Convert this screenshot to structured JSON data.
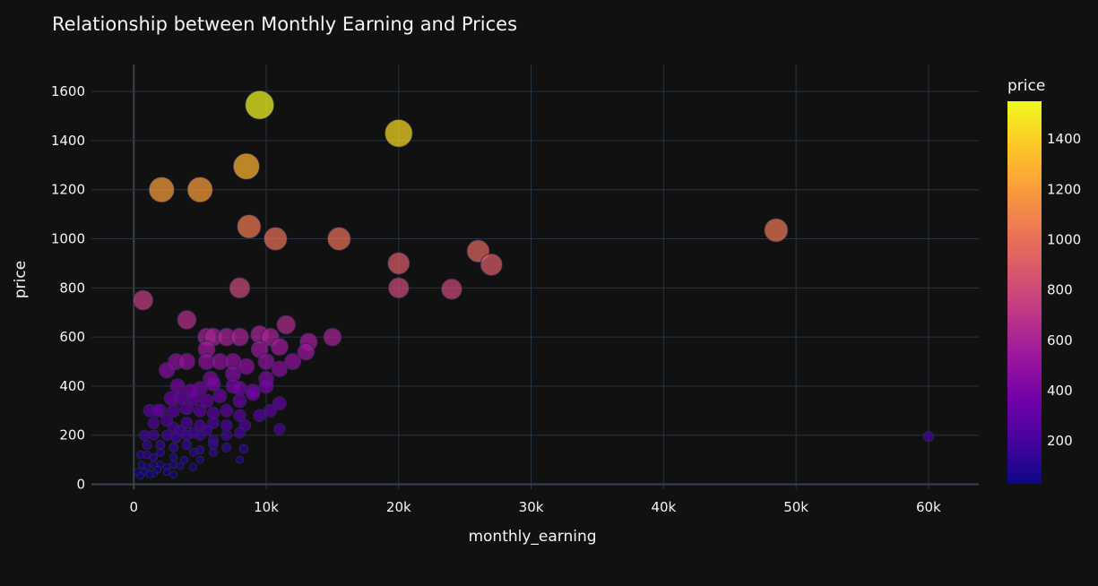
{
  "chart_data": {
    "type": "scatter",
    "title": "Relationship between Monthly Earning and Prices",
    "xlabel": "monthly_earning",
    "ylabel": "price",
    "xlim": [
      -3200,
      63800
    ],
    "ylim": [
      -20,
      1710
    ],
    "x_ticks": [
      0,
      10000,
      20000,
      30000,
      40000,
      50000,
      60000
    ],
    "x_tick_labels": [
      "0",
      "10k",
      "20k",
      "30k",
      "40k",
      "50k",
      "60k"
    ],
    "y_ticks": [
      0,
      200,
      400,
      600,
      800,
      1000,
      1200,
      1400,
      1600
    ],
    "y_tick_labels": [
      "0",
      "200",
      "400",
      "600",
      "800",
      "1000",
      "1200",
      "1400",
      "1600"
    ],
    "grid": true,
    "size_encodes": "price",
    "colorbar": {
      "title": "price",
      "min": 30,
      "max": 1550,
      "ticks": [
        200,
        400,
        600,
        800,
        1000,
        1200,
        1400
      ],
      "tick_labels": [
        "200",
        "400",
        "600",
        "800",
        "1000",
        "1200",
        "1400"
      ]
    },
    "colorscale": [
      "#0d0887",
      "#46039f",
      "#7201a8",
      "#9c179e",
      "#bd3786",
      "#d8576b",
      "#ed7953",
      "#fb9f3a",
      "#fdca26",
      "#f0f921"
    ],
    "points": [
      [
        9500,
        1545
      ],
      [
        20000,
        1430
      ],
      [
        8500,
        1295
      ],
      [
        2100,
        1200
      ],
      [
        5000,
        1200
      ],
      [
        8700,
        1050
      ],
      [
        10700,
        1000
      ],
      [
        15500,
        1000
      ],
      [
        48500,
        1035
      ],
      [
        20000,
        900
      ],
      [
        26000,
        950
      ],
      [
        27000,
        895
      ],
      [
        700,
        750
      ],
      [
        8000,
        800
      ],
      [
        20000,
        800
      ],
      [
        24000,
        795
      ],
      [
        4000,
        670
      ],
      [
        11500,
        650
      ],
      [
        5500,
        600
      ],
      [
        6000,
        600
      ],
      [
        7000,
        600
      ],
      [
        8000,
        600
      ],
      [
        9500,
        610
      ],
      [
        10300,
        600
      ],
      [
        15000,
        600
      ],
      [
        13200,
        580
      ],
      [
        5500,
        550
      ],
      [
        9500,
        550
      ],
      [
        11000,
        560
      ],
      [
        10000,
        500
      ],
      [
        12000,
        500
      ],
      [
        13000,
        540
      ],
      [
        3200,
        500
      ],
      [
        4000,
        500
      ],
      [
        5500,
        500
      ],
      [
        6500,
        500
      ],
      [
        7500,
        500
      ],
      [
        8500,
        480
      ],
      [
        11000,
        470
      ],
      [
        2500,
        465
      ],
      [
        5800,
        430
      ],
      [
        7500,
        450
      ],
      [
        10000,
        430
      ],
      [
        3300,
        400
      ],
      [
        4300,
        380
      ],
      [
        5000,
        390
      ],
      [
        6000,
        410
      ],
      [
        7500,
        400
      ],
      [
        8000,
        390
      ],
      [
        9000,
        380
      ],
      [
        10000,
        400
      ],
      [
        2800,
        350
      ],
      [
        3500,
        350
      ],
      [
        4500,
        350
      ],
      [
        5500,
        340
      ],
      [
        6500,
        360
      ],
      [
        8000,
        340
      ],
      [
        9000,
        370
      ],
      [
        11000,
        330
      ],
      [
        2000,
        300
      ],
      [
        3000,
        300
      ],
      [
        4000,
        310
      ],
      [
        5000,
        300
      ],
      [
        6000,
        290
      ],
      [
        7000,
        300
      ],
      [
        8000,
        280
      ],
      [
        9500,
        280
      ],
      [
        10300,
        300
      ],
      [
        1200,
        300
      ],
      [
        1800,
        300
      ],
      [
        1500,
        250
      ],
      [
        2500,
        260
      ],
      [
        3000,
        230
      ],
      [
        4000,
        250
      ],
      [
        5000,
        240
      ],
      [
        6000,
        250
      ],
      [
        7000,
        240
      ],
      [
        8400,
        240
      ],
      [
        3500,
        220
      ],
      [
        4500,
        210
      ],
      [
        5500,
        220
      ],
      [
        800,
        200
      ],
      [
        1500,
        200
      ],
      [
        2500,
        200
      ],
      [
        3200,
        190
      ],
      [
        4000,
        200
      ],
      [
        5000,
        200
      ],
      [
        6000,
        180
      ],
      [
        7000,
        200
      ],
      [
        8000,
        210
      ],
      [
        11000,
        225
      ],
      [
        60000,
        195
      ],
      [
        1000,
        160
      ],
      [
        2000,
        160
      ],
      [
        3000,
        150
      ],
      [
        4000,
        160
      ],
      [
        5000,
        140
      ],
      [
        6000,
        160
      ],
      [
        7000,
        150
      ],
      [
        8300,
        145
      ],
      [
        4500,
        130
      ],
      [
        500,
        120
      ],
      [
        1000,
        120
      ],
      [
        1500,
        110
      ],
      [
        2000,
        130
      ],
      [
        3000,
        110
      ],
      [
        3800,
        100
      ],
      [
        5000,
        100
      ],
      [
        8000,
        100
      ],
      [
        6000,
        130
      ],
      [
        600,
        80
      ],
      [
        1000,
        70
      ],
      [
        1500,
        80
      ],
      [
        2000,
        80
      ],
      [
        2500,
        70
      ],
      [
        3000,
        80
      ],
      [
        3500,
        75
      ],
      [
        4500,
        70
      ],
      [
        300,
        50
      ],
      [
        800,
        50
      ],
      [
        1200,
        40
      ],
      [
        1800,
        60
      ],
      [
        2500,
        50
      ],
      [
        3000,
        40
      ],
      [
        500,
        35
      ],
      [
        1500,
        45
      ]
    ]
  }
}
